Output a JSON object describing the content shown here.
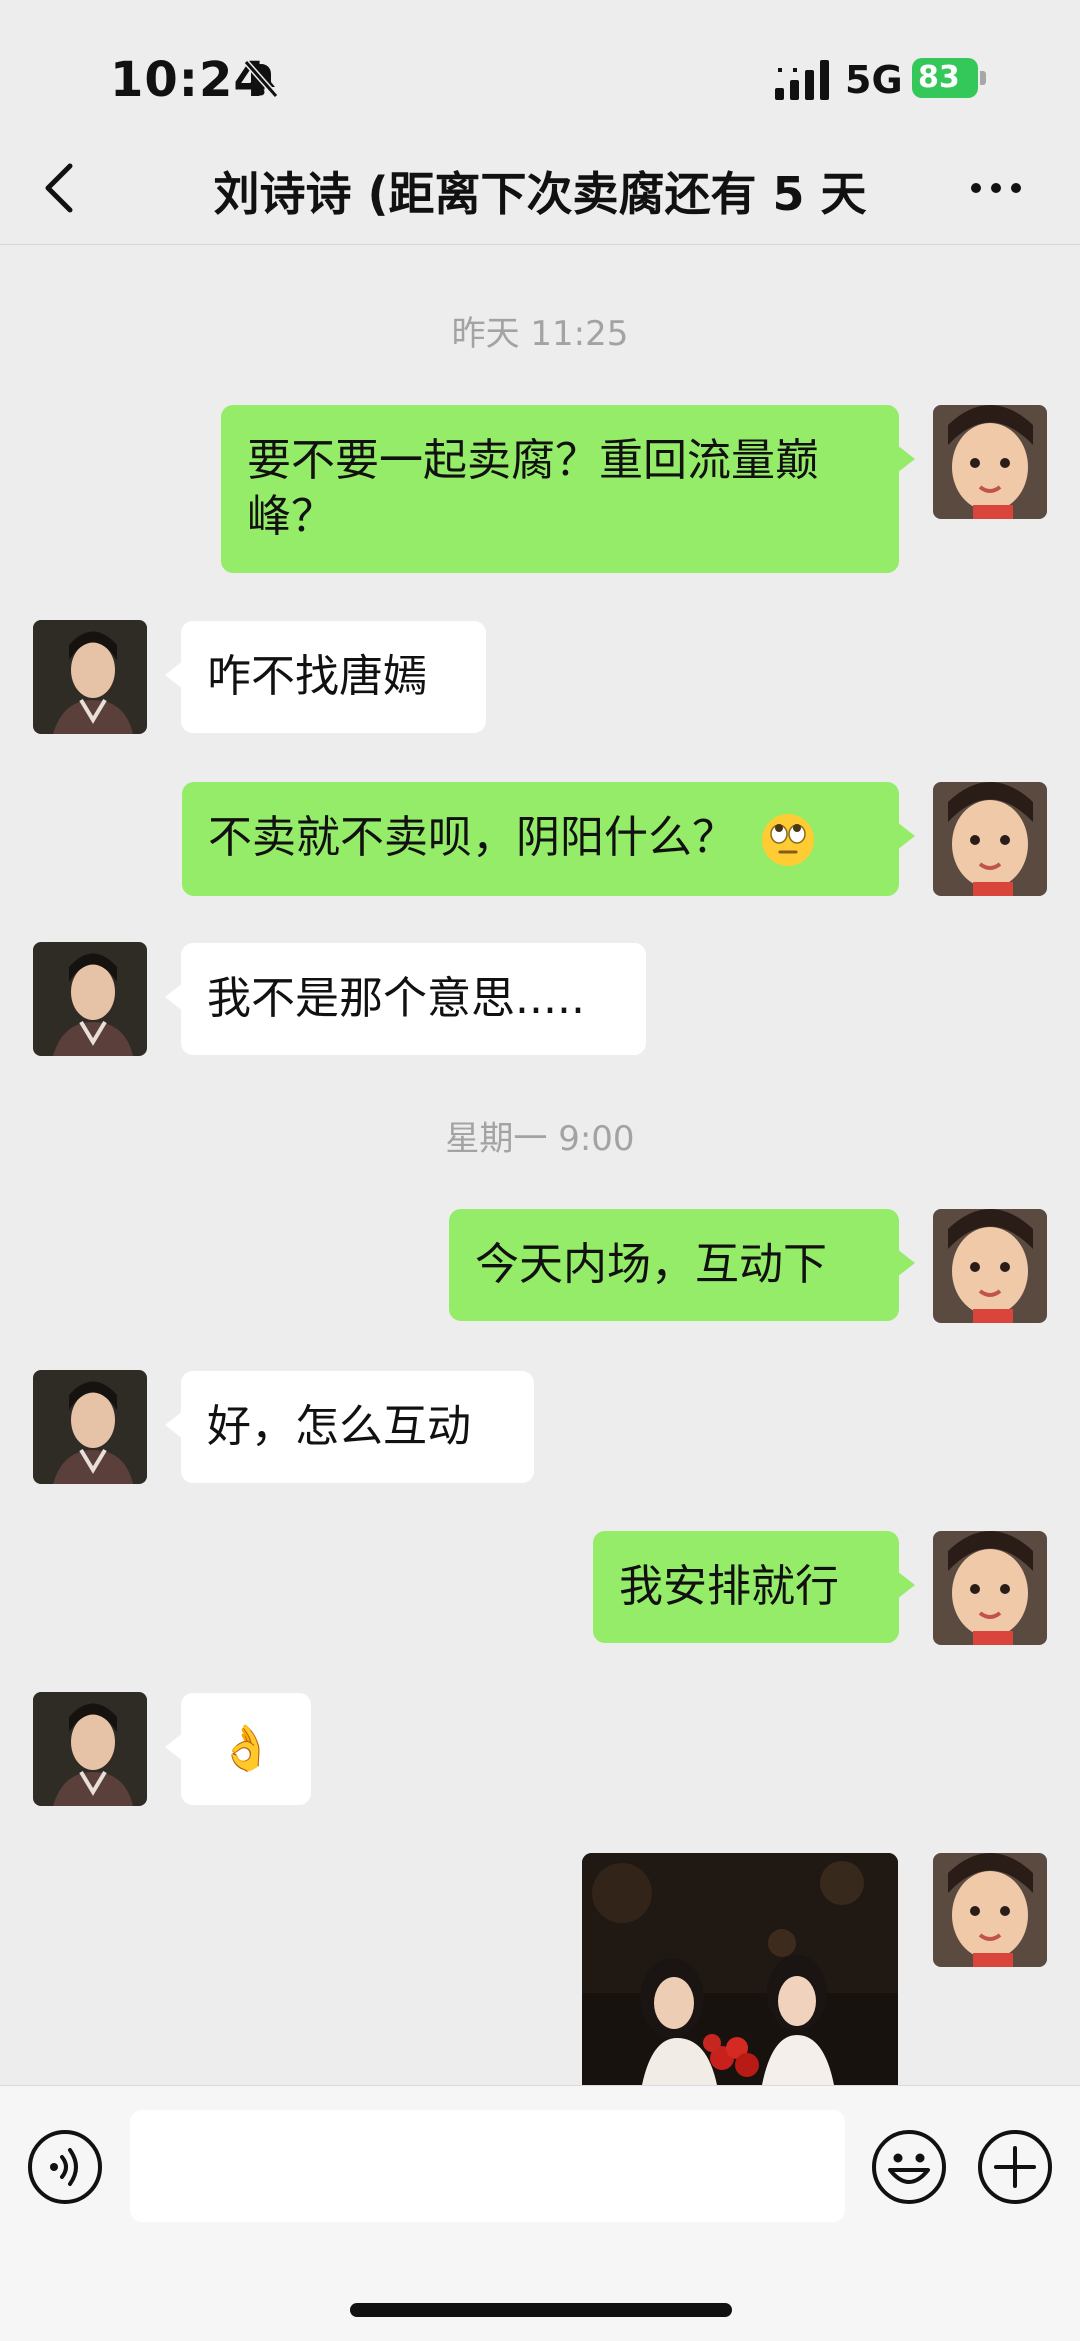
{
  "status_bar": {
    "time": "10:24",
    "network": "5G",
    "battery": "83",
    "icons": [
      "bell-muted-icon",
      "signal-icon",
      "battery-charging-icon"
    ]
  },
  "nav": {
    "title": "刘诗诗 (距离下次卖腐还有 5 天",
    "icons": [
      "back-chevron-icon",
      "more-dots-icon"
    ]
  },
  "stamps": [
    "昨天 11:25",
    "星期一 9:00"
  ],
  "messages": [
    {
      "from": "me",
      "text": "要不要一起卖腐？重回流量巅峰？"
    },
    {
      "from": "other",
      "text": "咋不找唐嫣"
    },
    {
      "from": "me",
      "text": "不卖就不卖呗，阴阳什么？",
      "emoji": "eye-roll-emoji"
    },
    {
      "from": "other",
      "text": "我不是那个意思....."
    },
    {
      "from": "me",
      "text": "今天内场，互动下"
    },
    {
      "from": "other",
      "text": "好，怎么互动"
    },
    {
      "from": "me",
      "text": "我安排就行"
    },
    {
      "from": "other",
      "text": "👌"
    },
    {
      "from": "me",
      "type": "image"
    }
  ],
  "input_bar": {
    "icons": [
      "voice-icon",
      "emoji-icon",
      "plus-icon"
    ]
  },
  "colors": {
    "background": "#ededed",
    "my_bubble": "#95ec69",
    "other_bubble": "#ffffff",
    "battery": "#34c759"
  }
}
